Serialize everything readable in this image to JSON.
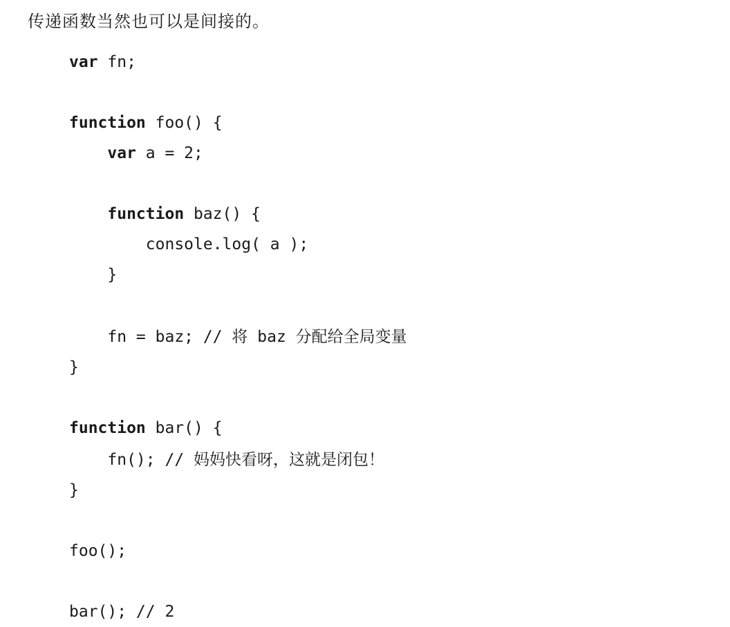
{
  "intro": "传递函数当然也可以是间接的。",
  "code": {
    "l1_kw": "var",
    "l1_rest": " fn;",
    "l3_kw": "function",
    "l3_rest": " foo() {",
    "l4_kw": "    var",
    "l4_rest": " a = 2;",
    "l6_kw": "    function",
    "l6_rest": " baz() {",
    "l7": "        console.log( a );",
    "l8": "    }",
    "l10a": "    fn = baz; // ",
    "l10b_cjk": "将",
    "l10c": " baz ",
    "l10d_cjk": "分配给全局变量",
    "l11": "}",
    "l13_kw": "function",
    "l13_rest": " bar() {",
    "l14a": "    fn(); // ",
    "l14b_cjk": "妈妈快看呀，这就是闭包！",
    "l15": "}",
    "l17": "foo();",
    "l19": "bar(); // 2"
  }
}
